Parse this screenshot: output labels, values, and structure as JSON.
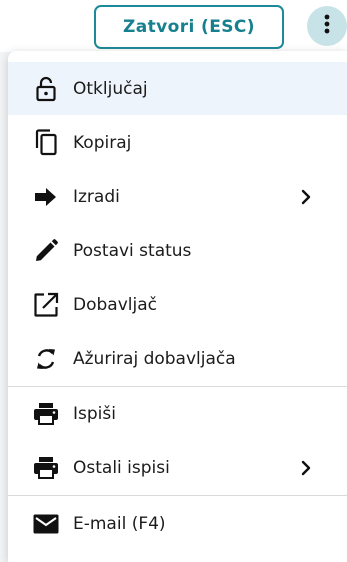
{
  "header": {
    "close_button_label": "Zatvori (ESC)",
    "more_icon": "more-vertical-icon"
  },
  "menu": {
    "items": [
      {
        "label": "Otključaj",
        "icon": "unlock-icon",
        "active": true
      },
      {
        "label": "Kopiraj",
        "icon": "copy-icon"
      },
      {
        "label": "Izradi",
        "icon": "arrow-right-icon",
        "has_submenu": true
      },
      {
        "label": "Postavi status",
        "icon": "pencil-icon"
      },
      {
        "label": "Dobavljač",
        "icon": "open-external-icon"
      },
      {
        "label": "Ažuriraj dobavljača",
        "icon": "refresh-icon"
      },
      {
        "label": "Ispiši",
        "icon": "printer-icon"
      },
      {
        "label": "Ostali ispisi",
        "icon": "printer-icon",
        "has_submenu": true
      },
      {
        "label": "E-mail (F4)",
        "icon": "mail-icon"
      }
    ]
  },
  "colors": {
    "accent": "#1d8a99",
    "active_row": "#eef4fb",
    "kebab_bg": "#c8e3e8"
  }
}
